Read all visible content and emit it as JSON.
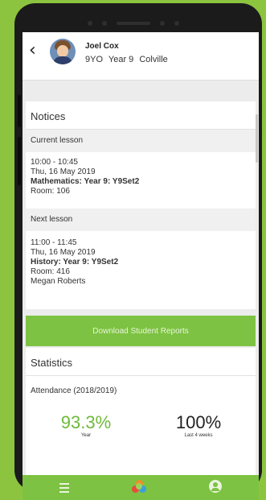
{
  "header": {
    "back_icon": "chevron-left-icon",
    "name": "Joel Cox",
    "form": "9YO",
    "year": "Year 9",
    "house": "Colville"
  },
  "notices": {
    "title": "Notices",
    "current_lesson_label": "Current lesson",
    "current_time": "10:00 - 10:45",
    "current_date": "Thu, 16 May 2019",
    "current_subject": "Mathematics: Year 9: Y9Set2",
    "current_room": "Room: 106",
    "next_lesson_label": "Next lesson",
    "next_time": "11:00 - 11:45",
    "next_date": "Thu, 16 May 2019",
    "next_subject": "History: Year 9: Y9Set2",
    "next_room": "Room: 416",
    "next_teacher": "Megan Roberts"
  },
  "download_button": "Download Student Reports",
  "statistics": {
    "title": "Statistics",
    "attendance_label": "Attendance (2018/2019)",
    "year_value": "93.3%",
    "year_label": "Year",
    "last4_value": "100%",
    "last4_label": "Last 4 weeks"
  },
  "navbar": {
    "menu_icon": "hamburger-menu-icon",
    "home_icon": "app-logo-icon",
    "profile_icon": "user-icon"
  },
  "colors": {
    "background_green": "#8cc43f",
    "button_green": "#7dc242",
    "percent_green": "#6eb93b"
  }
}
